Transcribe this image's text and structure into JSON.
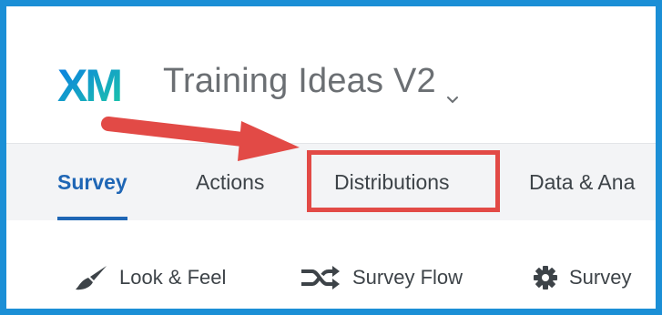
{
  "brand": {
    "logo_text": "XM",
    "logo_gradient_start": "#0a7ae6",
    "logo_gradient_end": "#1dc9a6"
  },
  "header": {
    "project_title": "Training Ideas V2"
  },
  "tabs": [
    {
      "label": "Survey",
      "active": true
    },
    {
      "label": "Actions",
      "active": false
    },
    {
      "label": "Distributions",
      "active": false,
      "highlighted": true
    },
    {
      "label": "Data & Ana",
      "active": false
    }
  ],
  "toolbar": {
    "items": [
      {
        "label": "Look & Feel",
        "icon": "paintbrush-icon"
      },
      {
        "label": "Survey Flow",
        "icon": "flow-shuffle-icon"
      },
      {
        "label": "Survey",
        "icon": "gear-icon"
      }
    ]
  },
  "annotation": {
    "arrow_color": "#e24a46",
    "box_color": "#e24a46"
  },
  "colors": {
    "frame": "#1b8fd6",
    "accent": "#1f66b5",
    "tab_bar_bg": "#f3f4f6",
    "text": "#3d4348",
    "title_gray": "#6b6f73"
  }
}
